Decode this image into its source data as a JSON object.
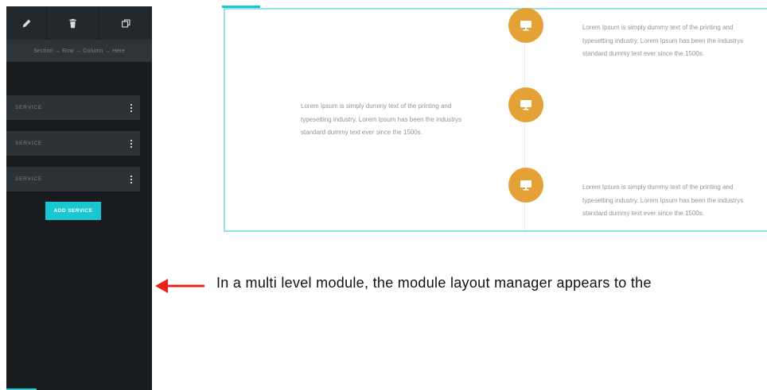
{
  "builder": {
    "breadcrumb": "Section → Row → Column → Here",
    "items": [
      {
        "label": "SERVICE"
      },
      {
        "label": "SERVICE"
      },
      {
        "label": "SERVICE"
      }
    ],
    "add_button": "ADD SERVICE",
    "icons": {
      "edit": "pencil-icon",
      "delete": "trash-icon",
      "duplicate": "copy-icon",
      "item_menu": "kebab-menu-icon"
    }
  },
  "preview": {
    "node_icon": "monitor-icon",
    "items": [
      {
        "text": "Lorem Ipsum is simply dummy text of the printing and typesetting industry. Lorem Ipsum has been the industrys standard dummy text ever since the 1500s."
      },
      {
        "text": "Lorem Ipsum is simply dummy text of the printing and typesetting industry. Lorem Ipsum has been the industrys standard dummy text ever since the 1500s."
      },
      {
        "text": "Lorem Ipsum is simply dummy text of the printing and typesetting industry. Lorem Ipsum has been the industrys standard dummy text ever since the 1500s."
      }
    ]
  },
  "annotation": {
    "text": "In a multi level module, the module layout manager appears to the"
  },
  "colors": {
    "accent": "#19c6d2",
    "node": "#e4a236",
    "panel": "#181c1f",
    "arrow": "#e8231e"
  }
}
